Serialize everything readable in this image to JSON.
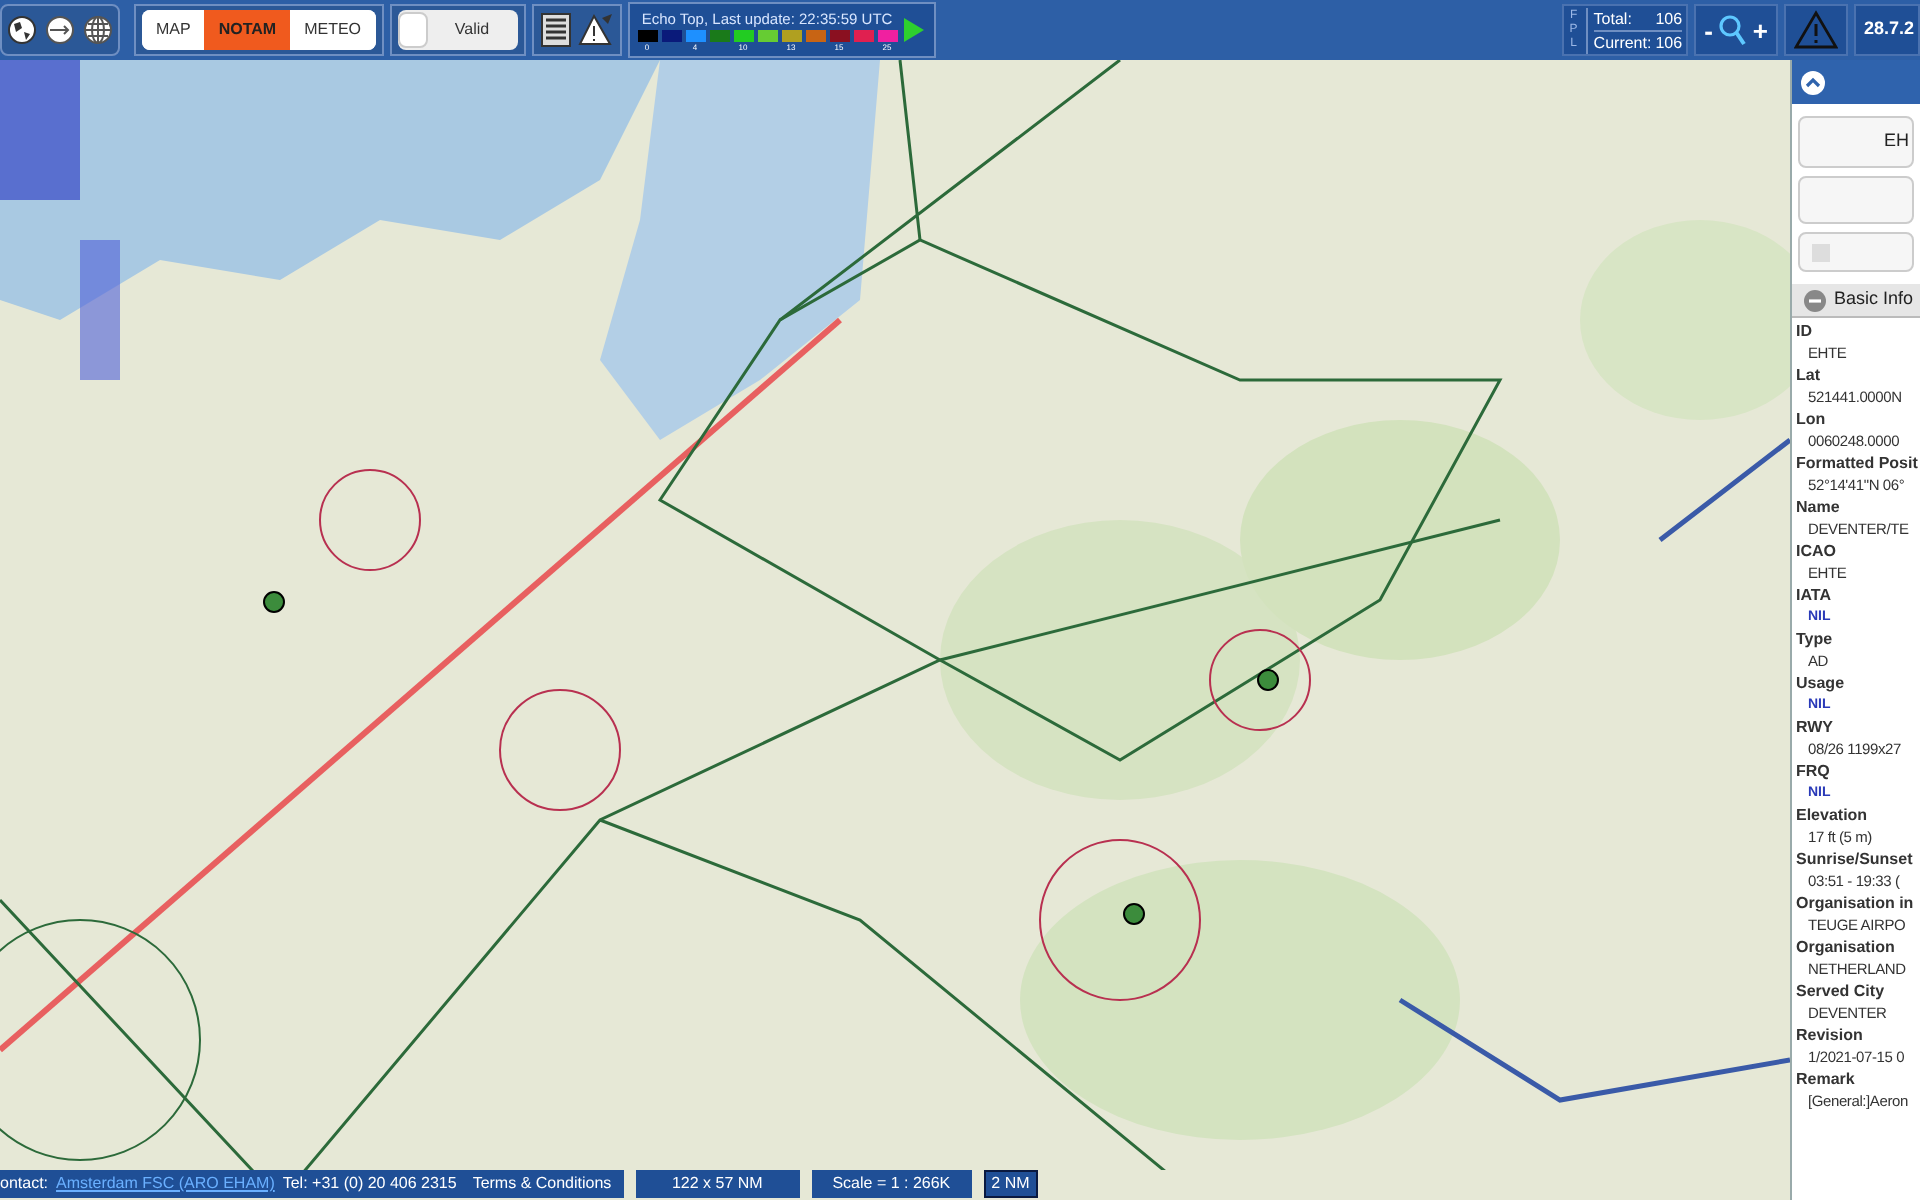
{
  "toolbar": {
    "layer_tabs": [
      {
        "label": "MAP",
        "selected": false
      },
      {
        "label": "NOTAM",
        "selected": true
      },
      {
        "label": "METEO",
        "selected": false
      }
    ],
    "valid_toggle": {
      "label": "Valid",
      "on": false
    },
    "legend": {
      "title": "Echo Top, Last update: 22:35:59 UTC",
      "swatches": [
        {
          "color": "#000000",
          "label": "0"
        },
        {
          "color": "#0a1a7a"
        },
        {
          "color": "#1e90ff",
          "label": "4"
        },
        {
          "color": "#1a7a1a"
        },
        {
          "color": "#22cc22",
          "label": "10"
        },
        {
          "color": "#66cc33"
        },
        {
          "color": "#b0a020",
          "label": "13"
        },
        {
          "color": "#c86414"
        },
        {
          "color": "#8a1020",
          "label": "15"
        },
        {
          "color": "#e02050"
        },
        {
          "color": "#f020a0",
          "label": "25"
        }
      ]
    },
    "fpl": {
      "tag": "FPL",
      "total_label": "Total:",
      "total": "106",
      "current_label": "Current:",
      "current": "106"
    },
    "zoom": {
      "minus": "-",
      "plus": "+"
    },
    "date": "28.7.2"
  },
  "panel": {
    "title_field": "EH",
    "checkbox": {
      "checked": false
    },
    "section": "Basic Info",
    "fields": [
      {
        "label": "ID",
        "value": "EHTE",
        "kind": "text"
      },
      {
        "label": "Lat",
        "value": "521441.0000N",
        "kind": "text"
      },
      {
        "label": "Lon",
        "value": "0060248.0000",
        "kind": "text"
      },
      {
        "label": "Formatted Posit",
        "value": "52°14'41\"N 06°",
        "kind": "text"
      },
      {
        "label": "Name",
        "value": "DEVENTER/TE",
        "kind": "text"
      },
      {
        "label": "ICAO",
        "value": "EHTE",
        "kind": "text"
      },
      {
        "label": "IATA",
        "value": "NIL",
        "kind": "nil"
      },
      {
        "label": "Type",
        "value": "AD",
        "kind": "text"
      },
      {
        "label": "Usage",
        "value": "NIL",
        "kind": "nil"
      },
      {
        "label": "RWY",
        "value": "08/26 1199x27",
        "kind": "text"
      },
      {
        "label": "FRQ",
        "value": "NIL",
        "kind": "nil"
      },
      {
        "label": "Elevation",
        "value": "17 ft (5 m)",
        "kind": "text"
      },
      {
        "label": "Sunrise/Sunset",
        "value": "03:51 - 19:33 (",
        "kind": "text"
      },
      {
        "label": "Organisation in",
        "value": "TEUGE AIRPO",
        "kind": "text"
      },
      {
        "label": "Organisation",
        "value": "NETHERLAND",
        "kind": "text"
      },
      {
        "label": "Served City",
        "value": "DEVENTER",
        "kind": "text"
      },
      {
        "label": "Revision",
        "value": "1/2021-07-15 0",
        "kind": "text"
      },
      {
        "label": "Remark",
        "value": "[General:]Aeron",
        "kind": "text"
      }
    ]
  },
  "status_bar": {
    "contact_label": "ontact:",
    "contact_link": "Amsterdam FSC (ARO EHAM)",
    "phone": "Tel:  +31 (0) 20 406 2315",
    "terms": "Terms & Conditions",
    "extent": "122 x 57 NM",
    "scale": "Scale = 1 : 266K",
    "scale_bar": "2 NM"
  }
}
